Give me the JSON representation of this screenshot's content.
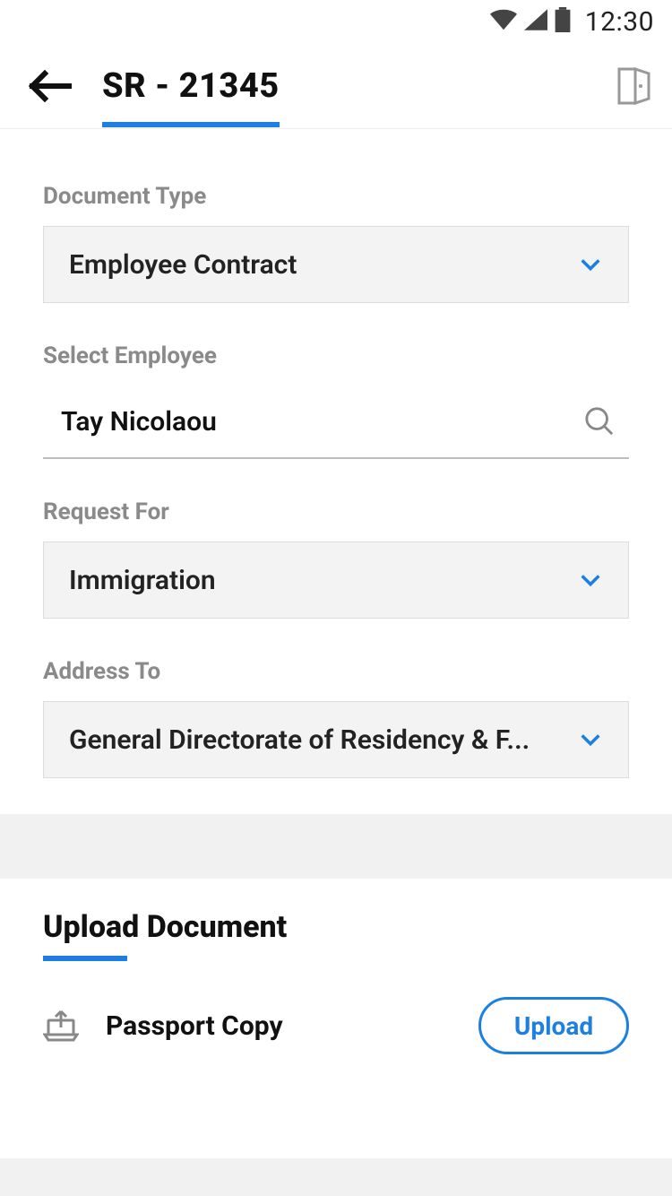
{
  "statusbar": {
    "time": "12:30"
  },
  "header": {
    "title": "SR - 21345"
  },
  "form": {
    "document_type": {
      "label": "Document Type",
      "value": "Employee Contract"
    },
    "select_employee": {
      "label": "Select Employee",
      "value": "Tay Nicolaou"
    },
    "request_for": {
      "label": "Request For",
      "value": "Immigration"
    },
    "address_to": {
      "label": "Address To",
      "value": "General Directorate of Residency & F..."
    }
  },
  "upload": {
    "heading": "Upload Document",
    "items": [
      {
        "name": "Passport Copy",
        "button": "Upload"
      }
    ]
  },
  "colors": {
    "accent": "#1d7fe2"
  }
}
